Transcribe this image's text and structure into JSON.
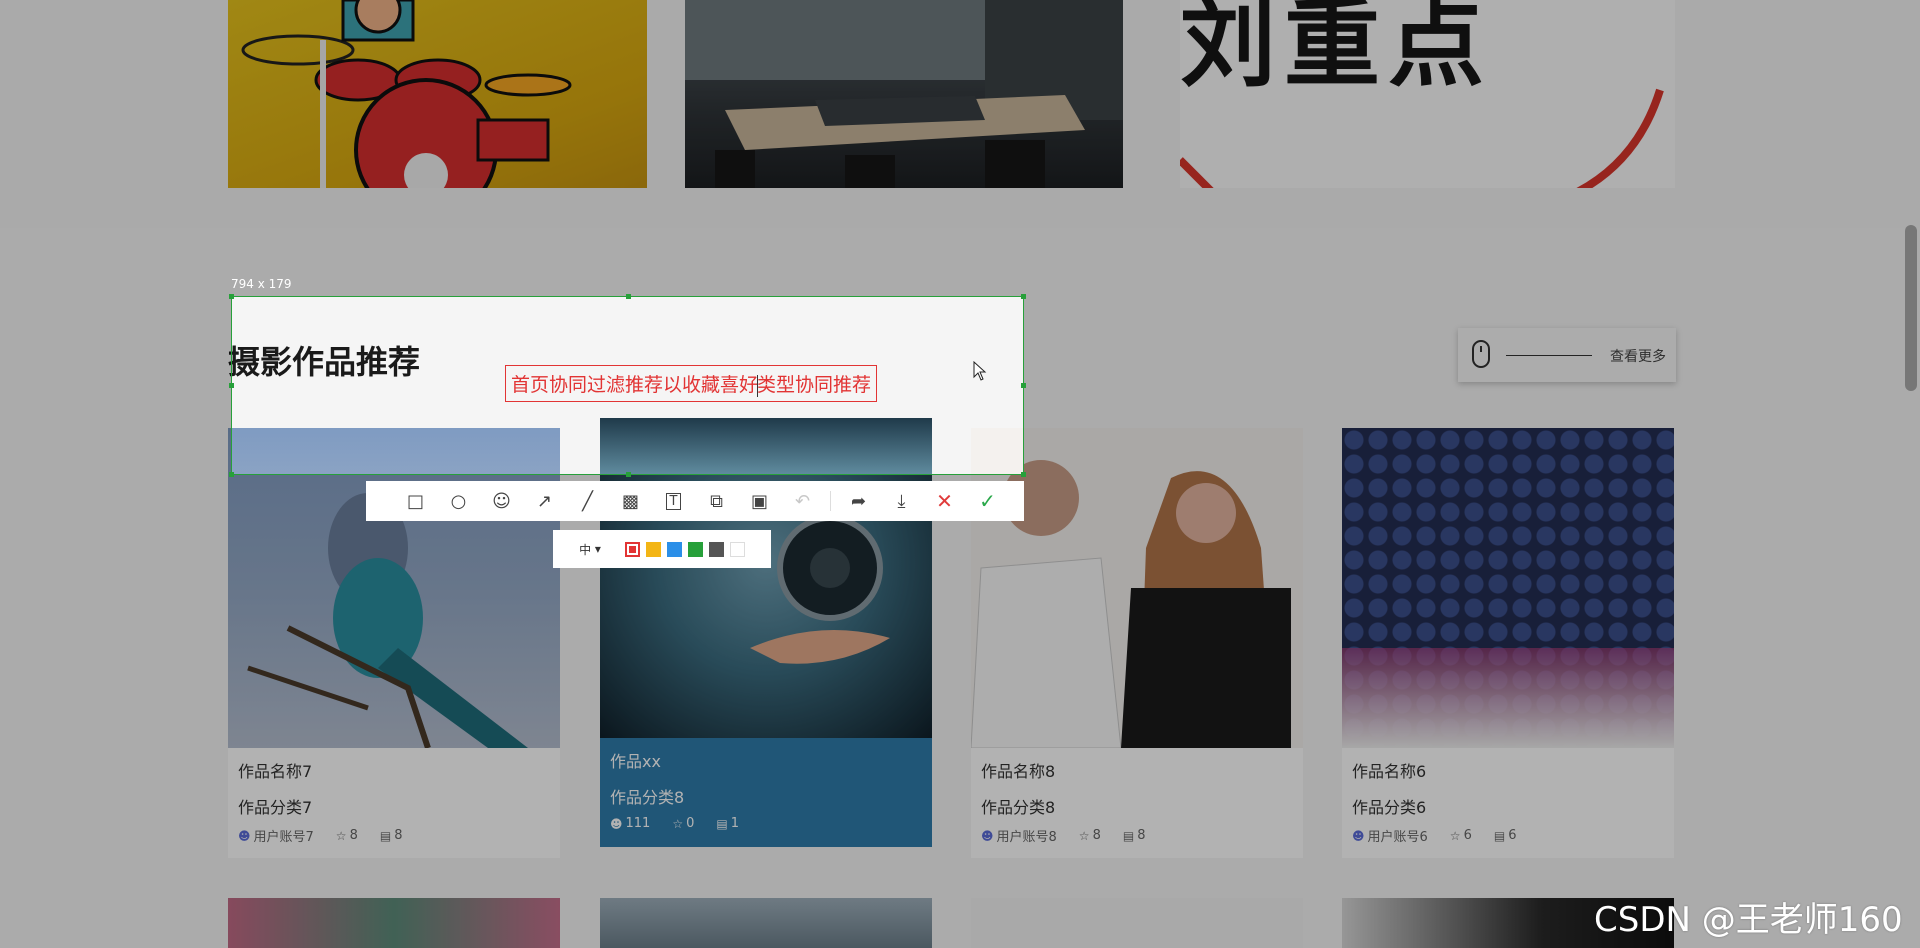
{
  "section": {
    "title": "摄影作品推荐",
    "more_label": "查看更多"
  },
  "top_image_text": "刘重点",
  "cards": [
    {
      "name": "作品名称7",
      "category": "作品分类7",
      "user": "用户账号7",
      "stars": "8",
      "comments": "8",
      "highlight": false
    },
    {
      "name": "作品xx",
      "category": "作品分类8",
      "user": "111",
      "stars": "0",
      "comments": "1",
      "highlight": true
    },
    {
      "name": "作品名称8",
      "category": "作品分类8",
      "user": "用户账号8",
      "stars": "8",
      "comments": "8",
      "highlight": false
    },
    {
      "name": "作品名称6",
      "category": "作品分类6",
      "user": "用户账号6",
      "stars": "6",
      "comments": "6",
      "highlight": false
    }
  ],
  "screenshot_tool": {
    "size_label": "794 x 179",
    "annotation_text_before": "首页协同过滤推荐以收藏喜好",
    "annotation_text_after": "类型协同推荐",
    "font_size_option": "中",
    "toolbar": [
      {
        "icon": "rectangle-icon"
      },
      {
        "icon": "ellipse-icon"
      },
      {
        "icon": "emoji-icon"
      },
      {
        "icon": "arrow-icon"
      },
      {
        "icon": "line-icon"
      },
      {
        "icon": "mosaic-icon"
      },
      {
        "icon": "text-icon"
      },
      {
        "icon": "pin-icon"
      },
      {
        "icon": "ocr-icon"
      },
      {
        "icon": "undo-icon"
      },
      {
        "icon": "share-icon"
      },
      {
        "icon": "download-icon"
      },
      {
        "icon": "close-icon"
      },
      {
        "icon": "confirm-icon"
      }
    ],
    "colors": [
      "#e23434",
      "#f3b515",
      "#2b8fe8",
      "#27a03a",
      "#555555",
      "#ffffff"
    ]
  },
  "watermark": "CSDN @王老师160"
}
